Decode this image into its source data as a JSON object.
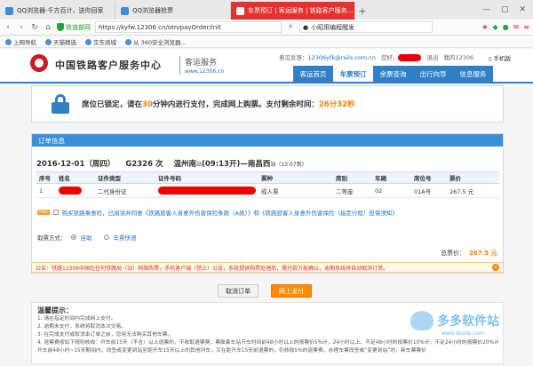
{
  "browser": {
    "tabs": [
      {
        "label": "QQ浏览器-千方百计，送你回家",
        "active": false
      },
      {
        "label": "QQ浏览器抢票",
        "active": false
      },
      {
        "label": "车票预订 | 客运服务 | 铁路客户服务...",
        "active": true
      }
    ],
    "new_tab": "+",
    "safe_label": "铁道部网",
    "url": "https://kyfw.12306.cn/otn/payOrder/init",
    "search_value": "小昭用编程醒发",
    "bookmarks": [
      "上网导航",
      "天猫精选",
      "京东商城",
      "从 360安全浏览器..."
    ]
  },
  "site": {
    "brand": "中国铁路客户服务中心",
    "sub": "客运服务",
    "sub_domain": "www.12306.cn",
    "feedback_label": "意见反馈：",
    "feedback_mail": "12306yfk@rails.com.cn",
    "greeting": "您好，",
    "logout": "退出",
    "my_label": "我的12306",
    "mobile": "手机版",
    "nav": [
      {
        "label": "客运首页",
        "active": false
      },
      {
        "label": "车票预订",
        "active": true
      },
      {
        "label": "余票查询",
        "active": false
      },
      {
        "label": "出行向导",
        "active": false
      },
      {
        "label": "信息服务",
        "active": false
      }
    ]
  },
  "notice": {
    "part1": "席位已锁定，请在",
    "minutes": "30",
    "part2": "分钟内进行支付，完成网上购票。支付剩余时间：",
    "remaining": "26分32秒"
  },
  "order": {
    "title": "订单信息",
    "date": "2016-12-01（周四）",
    "train": "G2326 次",
    "from": "温州南",
    "from_time": "(09:13开)",
    "to": "南昌西",
    "to_time": "站（13:07到）",
    "columns": [
      "序号",
      "姓名",
      "证件类型",
      "证件号码",
      "票种",
      "席别",
      "车厢",
      "席位号",
      "票价"
    ],
    "rows": [
      {
        "no": "1",
        "id_type": "二代身份证",
        "ticket_type": "成人票",
        "seat_class": "二等座",
        "car": "02",
        "seat_no": "01A号",
        "price": "267.5 元"
      }
    ],
    "insurance_text": "购买铁路乘意险，已阅读并同意《铁路旅客人身意外伤害保险条款（A款）》和《铁路旅客人身意外伤害保险（指定行程）投保须知》",
    "seat_pref_label": "取票方式：",
    "seat_pref_options": [
      "自助",
      "车票快递"
    ],
    "total_label": "总票价：",
    "total": "267.5 元"
  },
  "announce": "公告：铁路12306中国在任何铁路局（站）网络购票，手机客户端（禁止）公告，系统提供购票处理后，需付款方能确认，逾期系统将自动取消订单。",
  "actions": {
    "cancel": "取消订单",
    "pay": "网上支付"
  },
  "tips": {
    "title": "温馨提示：",
    "lines": [
      "1. 请在指定时间内完成网上支付。",
      "2. 逾期未支付，系统将取消本次交易。",
      "3. 在完成支付或取消本订单之前，您将无法购买其他车票。",
      "4. 退票费按如下规则核收：开车前15天（不含）以上退票的，不收取退票费；票面乘车站开车时间前48小时以上的按票价5%计，24小时以上、不足48小时的按票价10%计，不足24小时的按票价20%计。",
      "开车前48小时~15天期间内，改签或变更到站至距开车15天以上的其他列车，又在距开车15天前退票的，仍核收5%的退票费。办理车票改签或“变更到站”时，新车票票价"
    ]
  },
  "watermark": {
    "text": "多多软件站",
    "url": "www.duote.com"
  }
}
